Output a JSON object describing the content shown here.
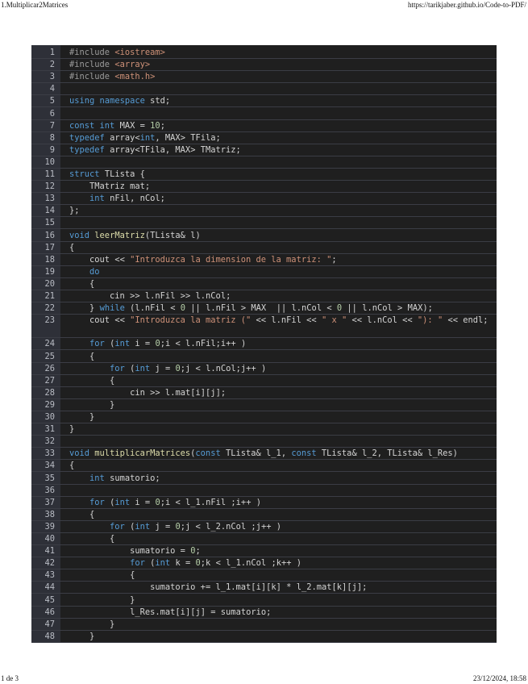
{
  "header": {
    "left": "1.Multiplicar2Matrices",
    "right": "https://tarikjaber.github.io/Code-to-PDF/"
  },
  "footer": {
    "left": "1 de 3",
    "right": "23/12/2024, 18:58"
  },
  "colors": {
    "background": "#1f1f1f",
    "gutter": "#2e3038",
    "keyword": "#569cd6",
    "string": "#ce9178",
    "preprocessor": "#9b9b9b",
    "default_text": "#d4d4d4"
  },
  "code": {
    "language": "cpp",
    "lines": [
      {
        "n": "1",
        "text": "#include <iostream>"
      },
      {
        "n": "2",
        "text": "#include <array>"
      },
      {
        "n": "3",
        "text": "#include <math.h>"
      },
      {
        "n": "4",
        "text": ""
      },
      {
        "n": "5",
        "text": "using namespace std;"
      },
      {
        "n": "6",
        "text": ""
      },
      {
        "n": "7",
        "text": "const int MAX = 10;"
      },
      {
        "n": "8",
        "text": "typedef array<int, MAX> TFila;"
      },
      {
        "n": "9",
        "text": "typedef array<TFila, MAX> TMatriz;"
      },
      {
        "n": "10",
        "text": ""
      },
      {
        "n": "11",
        "text": "struct TLista {"
      },
      {
        "n": "12",
        "text": "    TMatriz mat;"
      },
      {
        "n": "13",
        "text": "    int nFil, nCol;"
      },
      {
        "n": "14",
        "text": "};"
      },
      {
        "n": "15",
        "text": ""
      },
      {
        "n": "16",
        "text": "void leerMatriz(TLista& l)"
      },
      {
        "n": "17",
        "text": "{"
      },
      {
        "n": "18",
        "text": "    cout << \"Introduzca la dimension de la matriz: \";"
      },
      {
        "n": "19",
        "text": "    do"
      },
      {
        "n": "20",
        "text": "    {"
      },
      {
        "n": "21",
        "text": "        cin >> l.nFil >> l.nCol;"
      },
      {
        "n": "22",
        "text": "    } while (l.nFil < 0 || l.nFil > MAX  || l.nCol < 0 || l.nCol > MAX);"
      },
      {
        "n": "23",
        "text": "    cout << \"Introduzca la matriz (\" << l.nFil << \" x \" << l.nCol << \"): \" << endl;"
      },
      {
        "n": "24",
        "text": "    for (int i = 0;i < l.nFil;i++ )"
      },
      {
        "n": "25",
        "text": "    {"
      },
      {
        "n": "26",
        "text": "        for (int j = 0;j < l.nCol;j++ )"
      },
      {
        "n": "27",
        "text": "        {"
      },
      {
        "n": "28",
        "text": "            cin >> l.mat[i][j];"
      },
      {
        "n": "29",
        "text": "        }"
      },
      {
        "n": "30",
        "text": "    }"
      },
      {
        "n": "31",
        "text": "}"
      },
      {
        "n": "32",
        "text": ""
      },
      {
        "n": "33",
        "text": "void multiplicarMatrices(const TLista& l_1, const TLista& l_2, TLista& l_Res)"
      },
      {
        "n": "34",
        "text": "{"
      },
      {
        "n": "35",
        "text": "    int sumatorio;"
      },
      {
        "n": "36",
        "text": ""
      },
      {
        "n": "37",
        "text": "    for (int i = 0;i < l_1.nFil ;i++ )"
      },
      {
        "n": "38",
        "text": "    {"
      },
      {
        "n": "39",
        "text": "        for (int j = 0;j < l_2.nCol ;j++ )"
      },
      {
        "n": "40",
        "text": "        {"
      },
      {
        "n": "41",
        "text": "            sumatorio = 0;"
      },
      {
        "n": "42",
        "text": "            for (int k = 0;k < l_1.nCol ;k++ )"
      },
      {
        "n": "43",
        "text": "            {"
      },
      {
        "n": "44",
        "text": "                sumatorio += l_1.mat[i][k] * l_2.mat[k][j];"
      },
      {
        "n": "45",
        "text": "            }"
      },
      {
        "n": "46",
        "text": "            l_Res.mat[i][j] = sumatorio;"
      },
      {
        "n": "47",
        "text": "        }"
      },
      {
        "n": "48",
        "text": "    }"
      }
    ]
  }
}
